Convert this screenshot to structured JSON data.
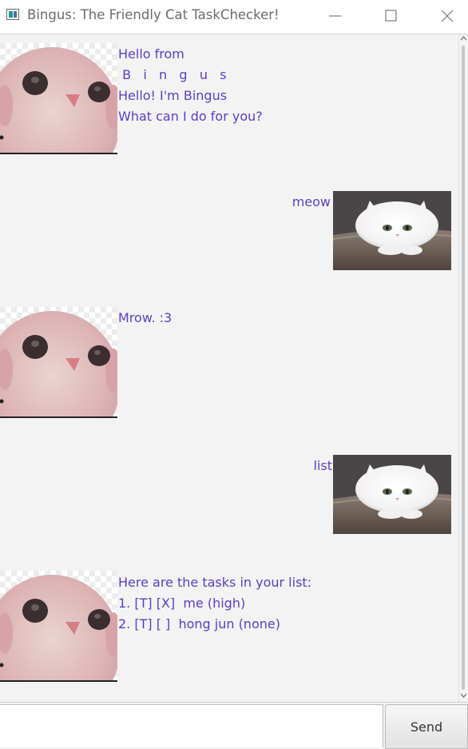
{
  "window": {
    "title": "Bingus: The Friendly Cat TaskChecker!",
    "controls": [
      "minimize",
      "maximize",
      "close"
    ]
  },
  "conversation": [
    {
      "sender": "bingus",
      "avatar": "bingus-hairless-cat-avatar",
      "lines": [
        "Hello from",
        " B   i   n   g   u   s",
        "Hello! I'm Bingus",
        "What can I do for you?"
      ]
    },
    {
      "sender": "user",
      "avatar": "white-persian-cat-avatar",
      "lines": [
        "meow"
      ]
    },
    {
      "sender": "bingus",
      "avatar": "bingus-hairless-cat-avatar",
      "lines": [
        "Mrow. :3"
      ]
    },
    {
      "sender": "user",
      "avatar": "white-persian-cat-avatar",
      "lines": [
        "list"
      ]
    },
    {
      "sender": "bingus",
      "avatar": "bingus-hairless-cat-avatar",
      "lines": [
        "Here are the tasks in your list:",
        "1. [T] [X]  me (high)",
        "2. [T] [ ]  hong jun (none)"
      ]
    }
  ],
  "input": {
    "value": "",
    "placeholder": ""
  },
  "send_button": {
    "label": "Send"
  },
  "colors": {
    "message_text": "#5b3fc4",
    "background": "#f3f3f3",
    "titlebar": "#ffffff"
  }
}
